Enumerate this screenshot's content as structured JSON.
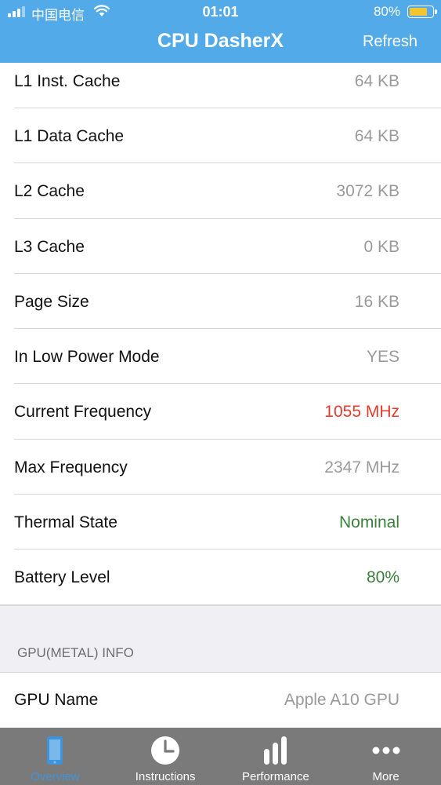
{
  "status_bar": {
    "carrier": "中国电信",
    "time": "01:01",
    "battery": "80%"
  },
  "nav": {
    "title": "CPU DasherX",
    "refresh": "Refresh"
  },
  "colors": {
    "nav_bar": "#52abe8",
    "value_gray": "#9a9a9a",
    "value_red": "#e53b2e",
    "value_green": "#3a7f3c",
    "tab_bar": "#7a7a7a",
    "tab_active": "#3f93d8"
  },
  "rows": [
    {
      "label": "L1 Inst. Cache",
      "value": "64 KB"
    },
    {
      "label": "L1 Data Cache",
      "value": "64 KB"
    },
    {
      "label": "L2 Cache",
      "value": "3072 KB"
    },
    {
      "label": "L3 Cache",
      "value": "0 KB"
    },
    {
      "label": "Page Size",
      "value": "16 KB"
    },
    {
      "label": "In Low Power Mode",
      "value": "YES"
    },
    {
      "label": "Current Frequency",
      "value": "1055 MHz"
    },
    {
      "label": "Max Frequency",
      "value": "2347 MHz"
    },
    {
      "label": "Thermal State",
      "value": "Nominal"
    },
    {
      "label": "Battery Level",
      "value": "80%"
    }
  ],
  "gpu_section": {
    "header": "GPU(METAL) INFO",
    "rows": [
      {
        "label": "GPU Name",
        "value": "Apple A10 GPU"
      }
    ]
  },
  "tabs": [
    {
      "label": "Overview",
      "icon": "phone-icon",
      "active": true
    },
    {
      "label": "Instructions",
      "icon": "clock-icon",
      "active": false
    },
    {
      "label": "Performance",
      "icon": "bar-chart-icon",
      "active": false
    },
    {
      "label": "More",
      "icon": "more-icon",
      "active": false
    }
  ]
}
